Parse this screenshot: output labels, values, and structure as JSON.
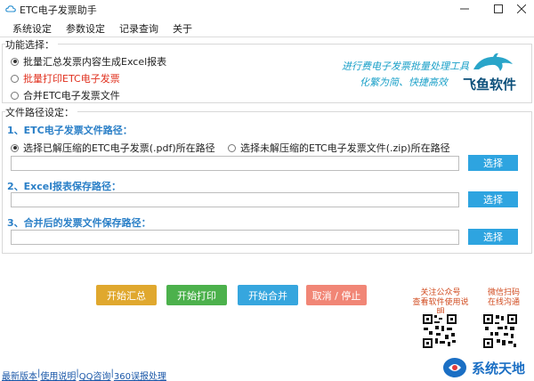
{
  "window": {
    "title": "ETC电子发票助手"
  },
  "menu": {
    "items": [
      "系统设定",
      "参数设定",
      "记录查询",
      "关于"
    ]
  },
  "function_section": {
    "title": "功能选择：",
    "options": [
      {
        "label": "批量汇总发票内容生成Excel报表",
        "checked": true,
        "color": "#222222"
      },
      {
        "label": "批量打印ETC电子发票",
        "checked": false,
        "color": "#e0301e"
      },
      {
        "label": "合并ETC电子发票文件",
        "checked": false,
        "color": "#222222"
      }
    ]
  },
  "brand": {
    "slogan_line1": "进行费电子发票批量处理工具",
    "slogan_line2": "化繁为简、快捷高效",
    "name": "飞鱼软件"
  },
  "path_section": {
    "title": "文件路径设定：",
    "etc_label": "1、ETC电子发票文件路径：",
    "source_options": [
      {
        "label": "选择已解压缩的ETC电子发票(.pdf)所在路径",
        "checked": true
      },
      {
        "label": "选择未解压缩的ETC电子发票文件(.zip)所在路径",
        "checked": false
      }
    ],
    "excel_label": "2、Excel报表保存路径：",
    "merge_label": "3、合并后的发票文件保存路径：",
    "etc_path_value": "",
    "excel_path_value": "",
    "merge_path_value": "",
    "select_button": "选择"
  },
  "actions": {
    "summary": {
      "label": "开始汇总",
      "color": "#e0a82e"
    },
    "print": {
      "label": "开始打印",
      "color": "#4cb14c"
    },
    "merge": {
      "label": "开始合并",
      "color": "#36a6de"
    },
    "cancel": {
      "label": "取消 / 停止",
      "color": "#f18676"
    }
  },
  "qr": {
    "left_caption1": "关注公众号",
    "left_caption2": "查看软件使用说明",
    "right_caption1": "微信扫码",
    "right_caption2": "在线沟通"
  },
  "footer": {
    "links": [
      "最新版本",
      "使用说明",
      "QQ咨询",
      "360误报处理"
    ]
  },
  "watermark": {
    "text": "系统天地"
  }
}
